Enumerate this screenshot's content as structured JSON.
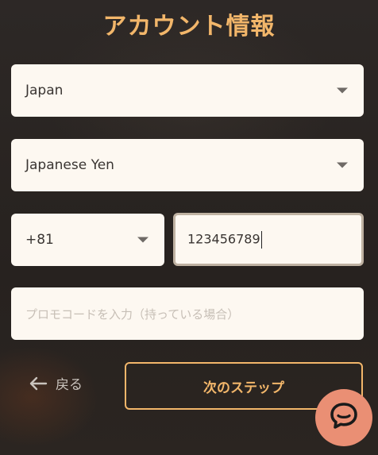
{
  "title": "アカウント情報",
  "country": {
    "value": "Japan"
  },
  "currency": {
    "value": "Japanese Yen"
  },
  "phone_code": {
    "value": "+81"
  },
  "phone_number": {
    "value": "123456789"
  },
  "promo": {
    "placeholder": "プロモコードを入力（持っている場合）"
  },
  "nav": {
    "back_label": "戻る",
    "next_label": "次のステップ"
  },
  "icons": {
    "back": "arrow-left-icon",
    "caret": "chevron-down-icon",
    "chat": "chat-bubble-icon"
  },
  "colors": {
    "accent": "#f2b66a",
    "field_bg": "#fdf8f1",
    "chat_bg": "#ea8f74",
    "page_bg": "#2b2624"
  }
}
